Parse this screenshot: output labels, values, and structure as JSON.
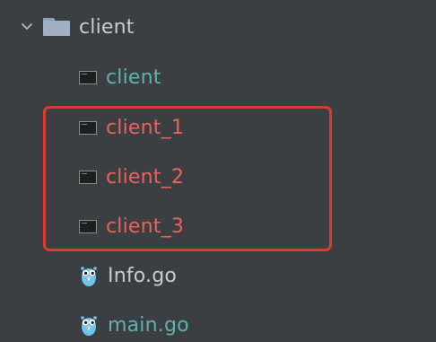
{
  "colors": {
    "background": "#3c3f41",
    "executable_text": "#5fb3ae",
    "highlighted_text": "#e8645c",
    "file_text": "#c8cbcf",
    "highlight_box": "#e03a2f"
  },
  "project_tree": {
    "folder": {
      "label": "client",
      "expanded": true,
      "icon": "folder-icon"
    },
    "items": [
      {
        "label": "client",
        "icon": "executable-icon"
      },
      {
        "label": "client_1",
        "icon": "executable-icon"
      },
      {
        "label": "client_2",
        "icon": "executable-icon"
      },
      {
        "label": "client_3",
        "icon": "executable-icon"
      },
      {
        "label": "Info.go",
        "icon": "go-gopher-icon"
      },
      {
        "label": "main.go",
        "icon": "go-gopher-icon"
      }
    ]
  }
}
